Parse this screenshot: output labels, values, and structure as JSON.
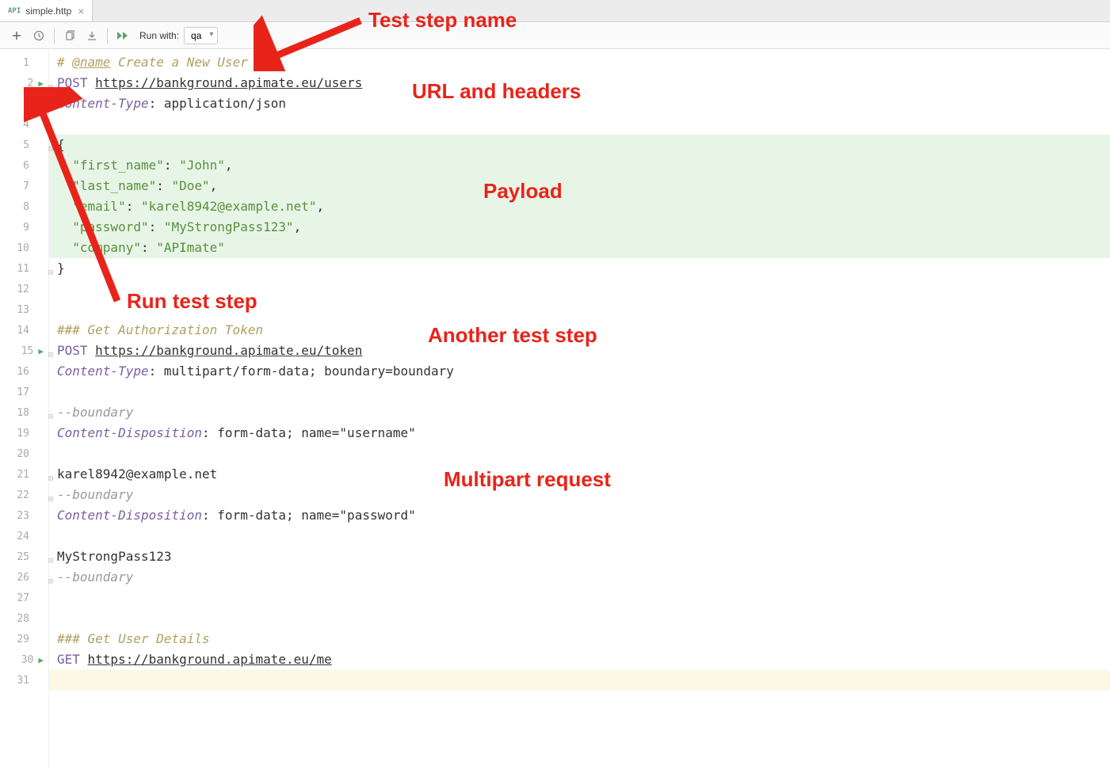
{
  "tab": {
    "filename": "simple.http"
  },
  "toolbar": {
    "run_with_label": "Run with:",
    "environment": "qa"
  },
  "lines": [
    {
      "n": 1,
      "run": false,
      "hl": "",
      "segments": [
        {
          "t": "# ",
          "c": "c-comment"
        },
        {
          "t": "@name",
          "c": "c-anno"
        },
        {
          "t": " Create a New User",
          "c": "c-comment"
        }
      ]
    },
    {
      "n": 2,
      "run": true,
      "hl": "",
      "fold": true,
      "segments": [
        {
          "t": "POST ",
          "c": "c-method"
        },
        {
          "t": "https://bankground.apimate.eu/users",
          "c": "c-url"
        }
      ]
    },
    {
      "n": 3,
      "run": false,
      "hl": "",
      "segments": [
        {
          "t": "Content-Type",
          "c": "c-header"
        },
        {
          "t": ": application/json",
          "c": "c-plain"
        }
      ]
    },
    {
      "n": 4,
      "run": false,
      "hl": "",
      "segments": []
    },
    {
      "n": 5,
      "run": false,
      "hl": "hl-green",
      "fold": true,
      "segments": [
        {
          "t": "{",
          "c": "c-plain"
        }
      ]
    },
    {
      "n": 6,
      "run": false,
      "hl": "hl-green",
      "segments": [
        {
          "t": "  \"first_name\"",
          "c": "c-key"
        },
        {
          "t": ": ",
          "c": "c-plain"
        },
        {
          "t": "\"John\"",
          "c": "c-str"
        },
        {
          "t": ",",
          "c": "c-plain"
        }
      ]
    },
    {
      "n": 7,
      "run": false,
      "hl": "hl-green",
      "segments": [
        {
          "t": "  \"last_name\"",
          "c": "c-key"
        },
        {
          "t": ": ",
          "c": "c-plain"
        },
        {
          "t": "\"Doe\"",
          "c": "c-str"
        },
        {
          "t": ",",
          "c": "c-plain"
        }
      ]
    },
    {
      "n": 8,
      "run": false,
      "hl": "hl-green",
      "segments": [
        {
          "t": "  \"email\"",
          "c": "c-key"
        },
        {
          "t": ": ",
          "c": "c-plain"
        },
        {
          "t": "\"karel8942@example.net\"",
          "c": "c-str"
        },
        {
          "t": ",",
          "c": "c-plain"
        }
      ]
    },
    {
      "n": 9,
      "run": false,
      "hl": "hl-green",
      "segments": [
        {
          "t": "  \"password\"",
          "c": "c-key"
        },
        {
          "t": ": ",
          "c": "c-plain"
        },
        {
          "t": "\"MyStrongPass123\"",
          "c": "c-str"
        },
        {
          "t": ",",
          "c": "c-plain"
        }
      ]
    },
    {
      "n": 10,
      "run": false,
      "hl": "hl-green",
      "segments": [
        {
          "t": "  \"company\"",
          "c": "c-key"
        },
        {
          "t": ": ",
          "c": "c-plain"
        },
        {
          "t": "\"APImate\"",
          "c": "c-str"
        }
      ]
    },
    {
      "n": 11,
      "run": false,
      "hl": "",
      "fold": true,
      "segments": [
        {
          "t": "}",
          "c": "c-plain"
        }
      ]
    },
    {
      "n": 12,
      "run": false,
      "hl": "",
      "segments": []
    },
    {
      "n": 13,
      "run": false,
      "hl": "",
      "segments": []
    },
    {
      "n": 14,
      "run": false,
      "hl": "",
      "segments": [
        {
          "t": "### Get Authorization Token",
          "c": "c-comment"
        }
      ]
    },
    {
      "n": 15,
      "run": true,
      "hl": "",
      "fold": true,
      "segments": [
        {
          "t": "POST ",
          "c": "c-method"
        },
        {
          "t": "https://bankground.apimate.eu/token",
          "c": "c-url"
        }
      ]
    },
    {
      "n": 16,
      "run": false,
      "hl": "",
      "segments": [
        {
          "t": "Content-Type",
          "c": "c-header"
        },
        {
          "t": ": multipart/form-data; boundary=boundary",
          "c": "c-plain"
        }
      ]
    },
    {
      "n": 17,
      "run": false,
      "hl": "",
      "segments": []
    },
    {
      "n": 18,
      "run": false,
      "hl": "",
      "fold": true,
      "segments": [
        {
          "t": "--boundary",
          "c": "c-boundary"
        }
      ]
    },
    {
      "n": 19,
      "run": false,
      "hl": "",
      "segments": [
        {
          "t": "Content-Disposition",
          "c": "c-header"
        },
        {
          "t": ": form-data; name=\"username\"",
          "c": "c-plain"
        }
      ]
    },
    {
      "n": 20,
      "run": false,
      "hl": "",
      "segments": []
    },
    {
      "n": 21,
      "run": false,
      "hl": "",
      "fold": true,
      "segments": [
        {
          "t": "karel8942@example.net",
          "c": "c-plain"
        }
      ]
    },
    {
      "n": 22,
      "run": false,
      "hl": "",
      "fold": true,
      "segments": [
        {
          "t": "--boundary",
          "c": "c-boundary"
        }
      ]
    },
    {
      "n": 23,
      "run": false,
      "hl": "",
      "segments": [
        {
          "t": "Content-Disposition",
          "c": "c-header"
        },
        {
          "t": ": form-data; name=\"password\"",
          "c": "c-plain"
        }
      ]
    },
    {
      "n": 24,
      "run": false,
      "hl": "",
      "segments": []
    },
    {
      "n": 25,
      "run": false,
      "hl": "",
      "fold": true,
      "segments": [
        {
          "t": "MyStrongPass123",
          "c": "c-plain"
        }
      ]
    },
    {
      "n": 26,
      "run": false,
      "hl": "",
      "fold": true,
      "segments": [
        {
          "t": "--boundary",
          "c": "c-boundary"
        }
      ]
    },
    {
      "n": 27,
      "run": false,
      "hl": "",
      "segments": []
    },
    {
      "n": 28,
      "run": false,
      "hl": "",
      "segments": []
    },
    {
      "n": 29,
      "run": false,
      "hl": "",
      "segments": [
        {
          "t": "### Get User Details",
          "c": "c-comment"
        }
      ]
    },
    {
      "n": 30,
      "run": true,
      "hl": "",
      "segments": [
        {
          "t": "GET ",
          "c": "c-method"
        },
        {
          "t": "https://bankground.apimate.eu/me",
          "c": "c-url"
        }
      ]
    },
    {
      "n": 31,
      "run": false,
      "hl": "hl-current",
      "segments": []
    }
  ],
  "annotations": {
    "test_step_name": "Test step name",
    "url_headers": "URL and headers",
    "payload": "Payload",
    "run_test_step": "Run test step",
    "another_test_step": "Another test step",
    "multipart_request": "Multipart request"
  }
}
